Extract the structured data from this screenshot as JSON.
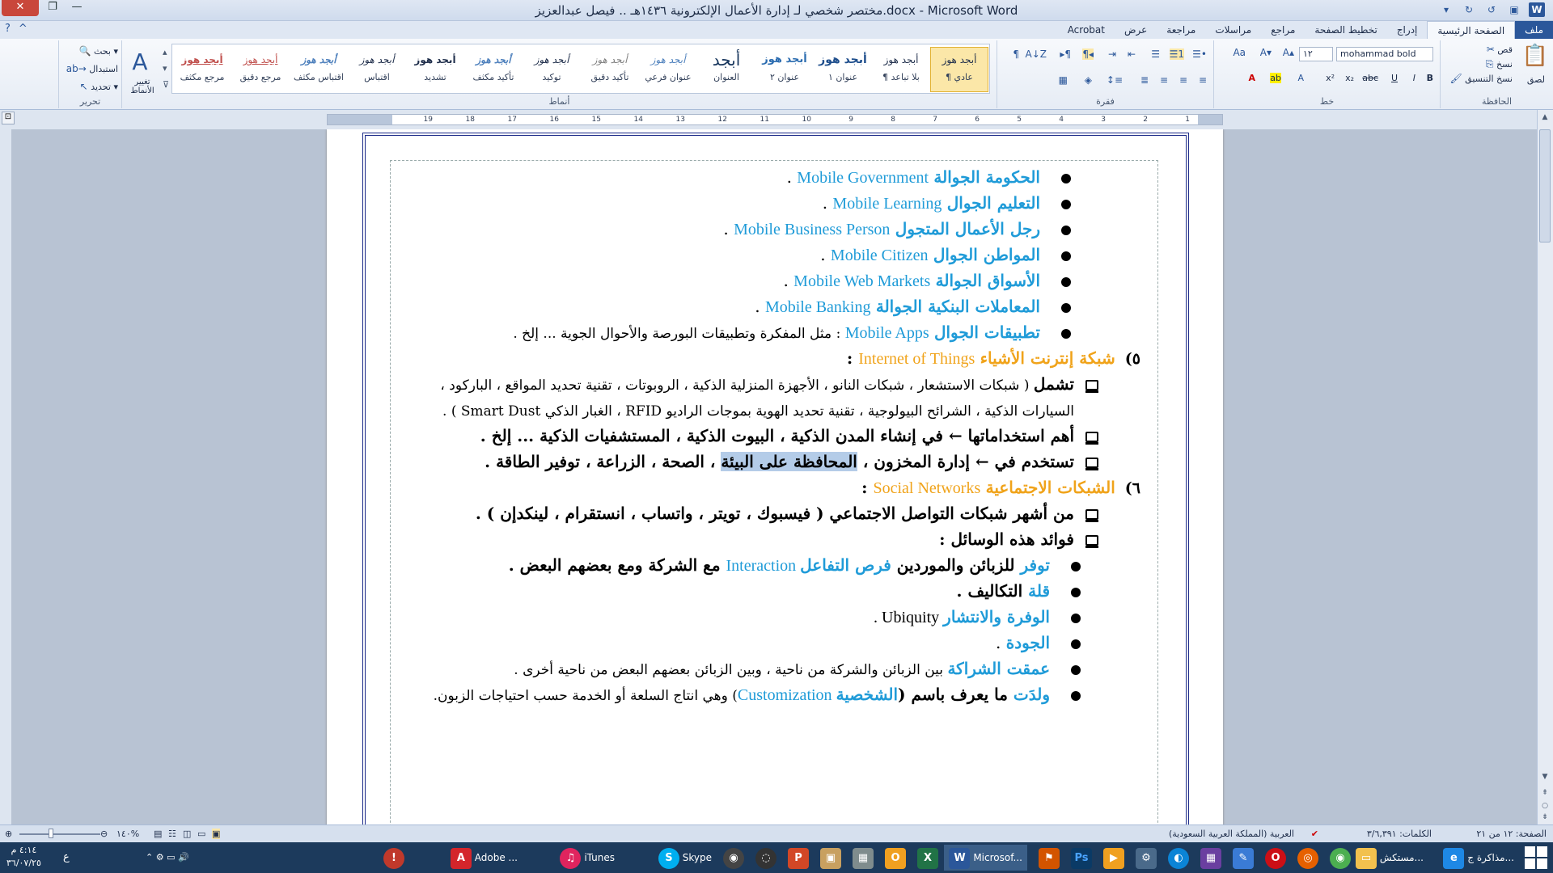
{
  "window": {
    "title": "مختصر شخصي لـ إدارة الأعمال الإلكترونية ١٤٣٦هـ .. فيصل عبدالعزيز.docx - Microsoft Word"
  },
  "tabs": [
    "ملف",
    "الصفحة الرئيسية",
    "إدراج",
    "تخطيط الصفحة",
    "مراجع",
    "مراسلات",
    "مراجعة",
    "عرض",
    "Acrobat"
  ],
  "ribbon": {
    "clipboard": {
      "label": "الحافظة",
      "paste": "لصق",
      "cut": "قص",
      "copy": "نسخ",
      "format_painter": "نسخ التنسيق"
    },
    "font": {
      "label": "خط",
      "name": "mohammad bold",
      "size": "١٢"
    },
    "paragraph": {
      "label": "فقرة"
    },
    "styles": {
      "label": "أنماط",
      "items": [
        {
          "sample": "أبجد هوز",
          "name": "¶ عادي"
        },
        {
          "sample": "أبجد هوز",
          "name": "¶ بلا تباعد"
        },
        {
          "sample": "أبجد هوز",
          "name": "عنوان ١"
        },
        {
          "sample": "أبجد هوز",
          "name": "عنوان ٢"
        },
        {
          "sample": "أبجد",
          "name": "العنوان"
        },
        {
          "sample": "أبجد هوز",
          "name": "عنوان فرعي"
        },
        {
          "sample": "أبجد هوز",
          "name": "تأكيد دقيق"
        },
        {
          "sample": "أبجد هوز",
          "name": "توكيد"
        },
        {
          "sample": "أبجد هوز",
          "name": "تأكيد مكثف"
        },
        {
          "sample": "أبجد هوز",
          "name": "تشديد"
        },
        {
          "sample": "أبجد هوز",
          "name": "اقتباس"
        },
        {
          "sample": "أبجد هوز",
          "name": "اقتباس مكثف"
        },
        {
          "sample": "أبجد هوز",
          "name": "مرجع دقيق"
        },
        {
          "sample": "أبجد هوز",
          "name": "مرجع مكثف"
        }
      ],
      "change_styles": "تغيير الأنماط"
    },
    "editing": {
      "label": "تحرير",
      "find": "بحث",
      "replace": "استبدال",
      "select": "تحديد"
    }
  },
  "ruler": {
    "ticks": [
      "1",
      "2",
      "3",
      "4",
      "5",
      "6",
      "7",
      "8",
      "9",
      "10",
      "11",
      "12",
      "13",
      "14",
      "15",
      "16",
      "17",
      "18",
      "19"
    ]
  },
  "document": {
    "lines": [
      {
        "kind": "bullet",
        "ar": "الحكومة الجوالة",
        "en": "Mobile Government",
        "tail": " ."
      },
      {
        "kind": "bullet",
        "ar": "التعليم الجوال",
        "en": "Mobile Learning",
        "tail": " ."
      },
      {
        "kind": "bullet",
        "ar": "رجل الأعمال المتجول",
        "en": "Mobile Business Person",
        "tail": " ."
      },
      {
        "kind": "bullet",
        "ar": "المواطن الجوال",
        "en": "Mobile Citizen",
        "tail": " ."
      },
      {
        "kind": "bullet",
        "ar": "الأسواق الجوالة",
        "en": "Mobile Web Markets",
        "tail": " ."
      },
      {
        "kind": "bullet",
        "ar": "المعاملات البنكية الجوالة",
        "en": "Mobile Banking",
        "tail": " ."
      },
      {
        "kind": "bullet",
        "ar": "تطبيقات الجوال",
        "en": "Mobile Apps",
        "tail": " : مثل المفكرة وتطبيقات البورصة والأحوال الجوية ... إلخ ."
      }
    ],
    "section5": {
      "num": "٥)",
      "ar": "شبكة إنترنت الأشياء",
      "en": "Internet of Things",
      "tail": " :"
    },
    "s5_item1_a": "تشمل",
    "s5_item1_b": " ( شبكات الاستشعار ، شبكات النانو ، الأجهزة المنزلية الذكية ، الروبوتات ، تقنية تحديد المواقع ، الباركود ،",
    "s5_item1_c": "السيارات الذكية ، الشرائح البيولوجية ، تقنية تحديد الهوية بموجات الراديو RFID ، الغبار الذكي Smart Dust ) .",
    "s5_item2": "أهم استخداماتها ← في إنشاء المدن الذكية ، البيوت الذكية ، المستشفيات الذكية ... إلخ .",
    "s5_item3_a": "تستخدم في ← إدارة المخزون ، ",
    "s5_item3_hl": "المحافظة على البيئة",
    "s5_item3_b": " ، الصحة ، الزراعة ، توفير الطاقة .",
    "section6": {
      "num": "٦)",
      "ar": "الشبكات الاجتماعية",
      "en": "Social Networks",
      "tail": " :"
    },
    "s6_item1": "من أشهر شبكات التواصل الاجتماعي ( فيسبوك ، تويتر ، واتساب ، انستقرام ، لينكدإن ) .",
    "s6_item2": "فوائد هذه الوسائل :",
    "benefits": [
      {
        "lead": "توفر",
        "mid": " للزبائن والموردين ",
        "blue": "فرص التفاعل",
        "en": " Interaction",
        "tail": " مع الشركة ومع بعضهم البعض ."
      },
      {
        "lead": "قلة",
        "mid": " التكاليف .",
        "blue": "",
        "en": "",
        "tail": ""
      },
      {
        "lead": "الوفرة والانتشار",
        "mid": " Ubiquity .",
        "blue": "",
        "en": "",
        "tail": ""
      },
      {
        "lead": "الجودة",
        "mid": " .",
        "blue": "",
        "en": "",
        "tail": ""
      },
      {
        "lead": "عمقت الشراكة",
        "mid": " بين الزبائن والشركة من ناحية ، وبين الزبائن بعضهم البعض من ناحية أخرى .",
        "blue": "",
        "en": "",
        "tail": ""
      },
      {
        "lead": "ولدَت",
        "mid": " ما يعرف باسم (",
        "blue": "الشخصية",
        "en": " Customization",
        "tail": ") وهي انتاج السلعة أو الخدمة حسب احتياجات الزبون."
      }
    ]
  },
  "statusbar": {
    "page": "الصفحة: ١٢ من ٢١",
    "words": "الكلمات: ٣/٦,٣٩١",
    "language": "العربية (المملكة العربية السعودية)",
    "zoom": "١٤٠%"
  },
  "taskbar": {
    "items": [
      "مذاكرة ج...",
      "مستكش...",
      "Microsof...",
      "Skype",
      "iTunes",
      "Adobe ..."
    ],
    "time": "٤:١٤ م",
    "date": "٣٦/٠٧/٢٥",
    "lang": "ع"
  }
}
